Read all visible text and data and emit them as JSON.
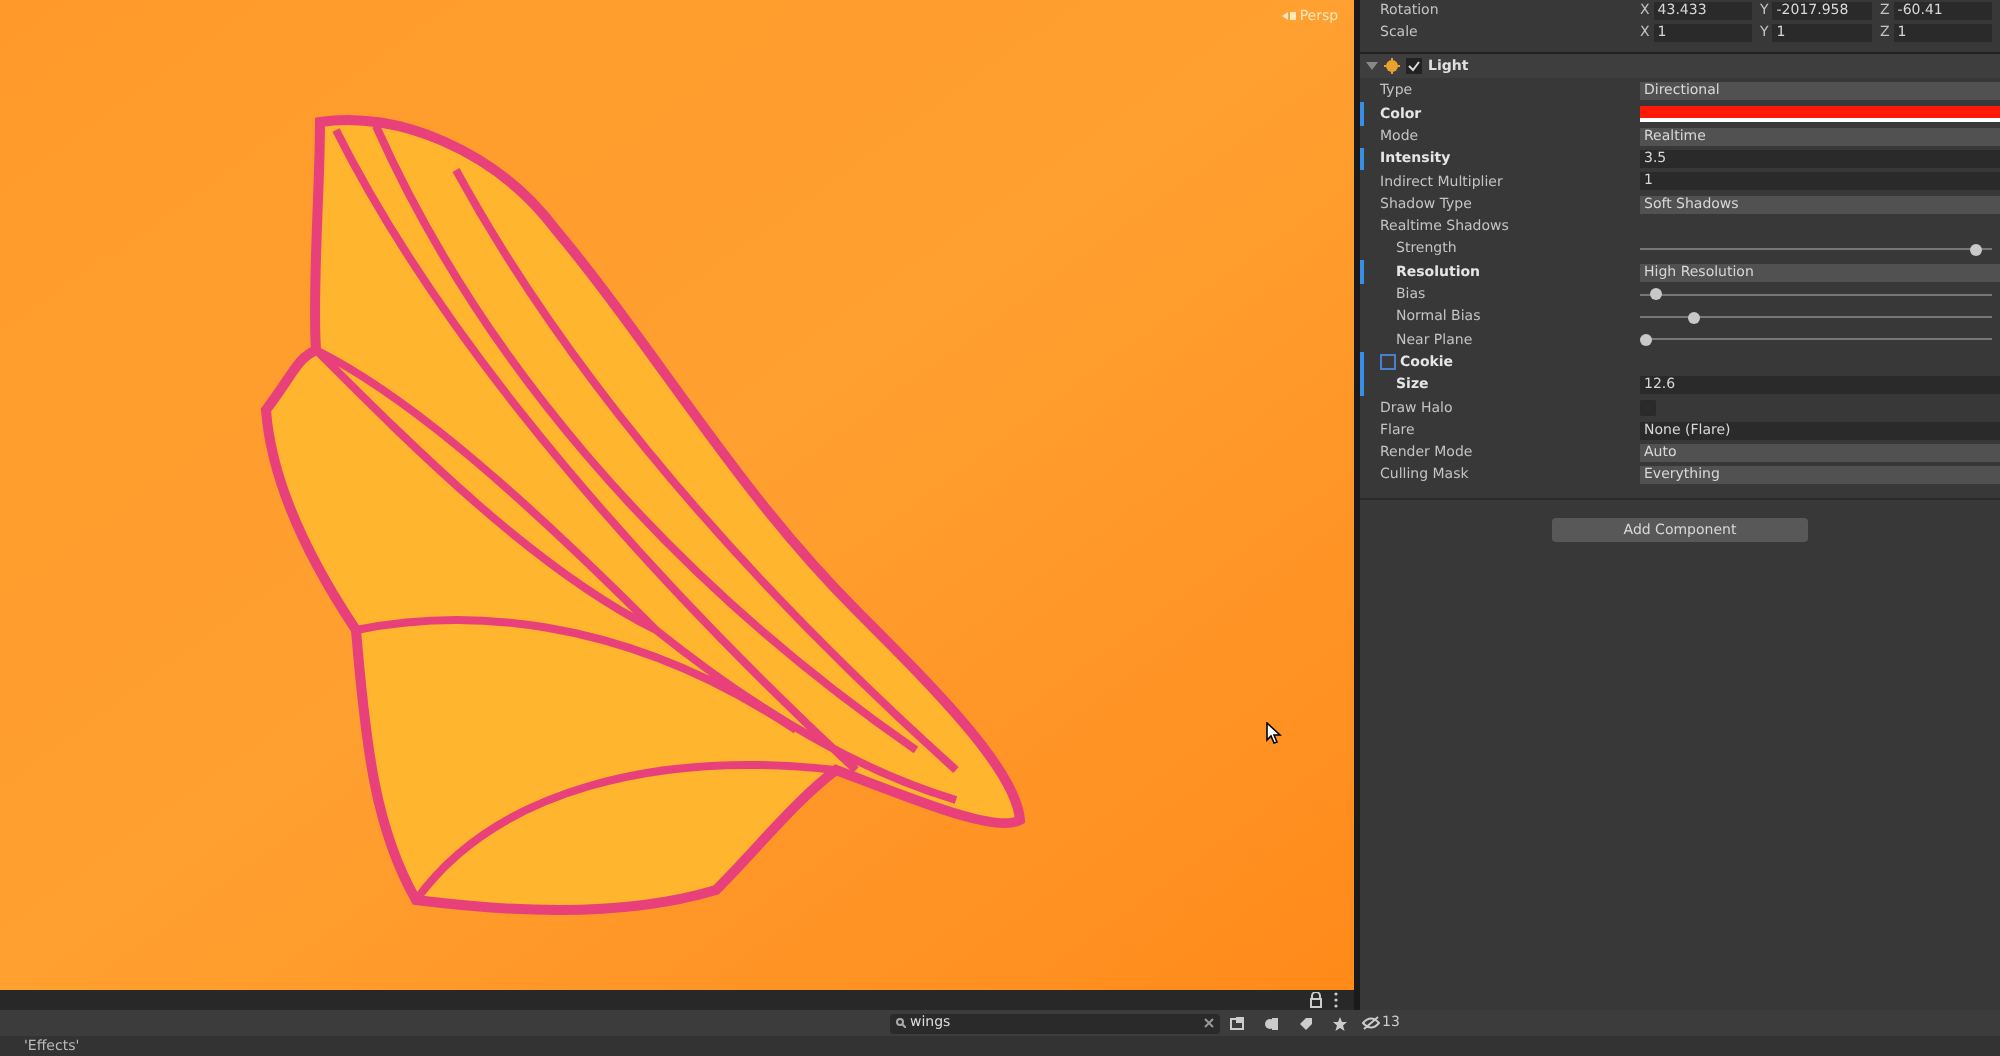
{
  "scene": {
    "view_label": "Persp"
  },
  "transform": [
    {
      "label": "Rotation",
      "axes": [
        {
          "axis": "X",
          "value": "43.433"
        },
        {
          "axis": "Y",
          "value": "-2017.958"
        },
        {
          "axis": "Z",
          "value": "-60.41"
        }
      ]
    },
    {
      "label": "Scale",
      "axes": [
        {
          "axis": "X",
          "value": "1"
        },
        {
          "axis": "Y",
          "value": "1"
        },
        {
          "axis": "Z",
          "value": "1"
        }
      ]
    }
  ],
  "component": {
    "title": "Light",
    "enabled": true,
    "expanded": true
  },
  "properties": [
    {
      "label": "Type",
      "kind": "dropdown",
      "value": "Directional",
      "overridden": false
    },
    {
      "label": "Color",
      "kind": "color",
      "color": "#ff1a0a",
      "overridden": true
    },
    {
      "label": "Mode",
      "kind": "dropdown",
      "value": "Realtime",
      "overridden": false
    },
    {
      "label": "Intensity",
      "kind": "number",
      "value": "3.5",
      "overridden": true
    },
    {
      "label": "Indirect Multiplier",
      "kind": "number",
      "value": "1",
      "overridden": false
    },
    {
      "label": "Shadow Type",
      "kind": "dropdown",
      "value": "Soft Shadows",
      "overridden": false
    },
    {
      "label": "Realtime Shadows",
      "kind": "header",
      "overridden": false,
      "children": [
        {
          "label": "Strength",
          "kind": "slider",
          "level": 0.97,
          "overridden": false
        },
        {
          "label": "Resolution",
          "kind": "dropdown",
          "value": "High Resolution",
          "overridden": true
        },
        {
          "label": "Bias",
          "kind": "slider",
          "level": 0.03,
          "overridden": false
        },
        {
          "label": "Normal Bias",
          "kind": "slider",
          "level": 0.14,
          "overridden": false
        },
        {
          "label": "Near Plane",
          "kind": "slider",
          "level": 0.0,
          "overridden": false
        }
      ]
    },
    {
      "label": "Cookie",
      "kind": "object-toggle",
      "overridden": true
    },
    {
      "label": "Size",
      "kind": "number",
      "value": "12.6",
      "overridden": true,
      "indented": true
    },
    {
      "label": "Draw Halo",
      "kind": "checkbox",
      "checked": false,
      "overridden": false
    },
    {
      "label": "Flare",
      "kind": "object",
      "value": "None (Flare)",
      "overridden": false
    },
    {
      "label": "Render Mode",
      "kind": "dropdown",
      "value": "Auto",
      "overridden": false
    },
    {
      "label": "Culling Mask",
      "kind": "dropdown",
      "value": "Everything",
      "overridden": false
    }
  ],
  "add_component": "Add Component",
  "project_bar": {
    "search_value": "wings",
    "hidden_count": "13"
  },
  "status_bar": {
    "text": "'Effects'"
  }
}
